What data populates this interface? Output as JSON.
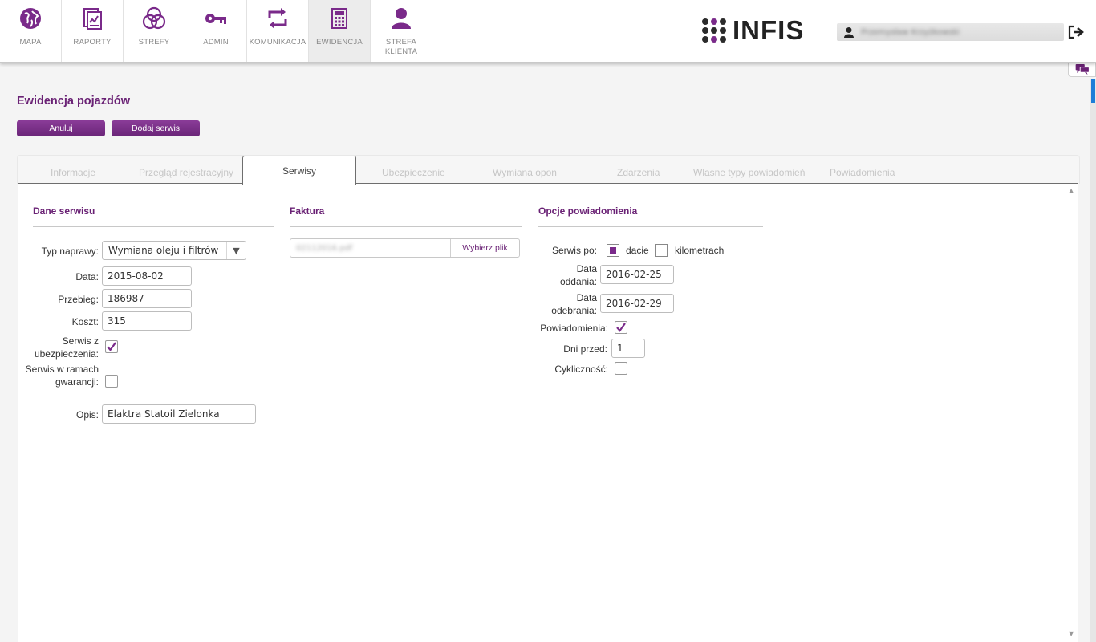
{
  "nav": {
    "items": [
      {
        "label": "MAPA",
        "icon": "globe-icon"
      },
      {
        "label": "RAPORTY",
        "icon": "report-icon"
      },
      {
        "label": "STREFY",
        "icon": "zones-icon"
      },
      {
        "label": "ADMIN",
        "icon": "key-icon"
      },
      {
        "label": "KOMUNIKACJA",
        "icon": "exchange-icon"
      },
      {
        "label": "EWIDENCJA",
        "icon": "calculator-icon"
      },
      {
        "label": "STREFA KLIENTA",
        "icon": "user-icon"
      }
    ],
    "active": "EWIDENCJA"
  },
  "brand": {
    "name": "INFIS"
  },
  "user": {
    "name": "Przemysław Krzyżkowski"
  },
  "page": {
    "title": "Ewidencja pojazdów"
  },
  "buttons": {
    "cancel": "Anuluj",
    "add_service": "Dodaj serwis"
  },
  "tabs": [
    "Informacje",
    "Przegląd rejestracyjny",
    "Serwisy",
    "Ubezpieczenie",
    "Wymiana opon",
    "Zdarzenia",
    "Własne typy powiadomień",
    "Powiadomienia"
  ],
  "active_tab": "Serwisy",
  "service": {
    "title": "Dane serwisu",
    "repair_type_label": "Typ naprawy:",
    "repair_type_value": "Wymiana oleju i filtrów",
    "date_label": "Data:",
    "date_value": "2015-08-02",
    "mileage_label": "Przebieg:",
    "mileage_value": "186987",
    "cost_label": "Koszt:",
    "cost_value": "315",
    "insurance_label": "Serwis z ubezpieczenia:",
    "insurance_checked": true,
    "warranty_label": "Serwis w ramach gwarancji:",
    "warranty_checked": false,
    "description_label": "Opis:",
    "description_value": "Elaktra Statoil Zielonka"
  },
  "invoice": {
    "title": "Faktura",
    "file_name": "02112016.pdf",
    "choose_file": "Wybierz plik"
  },
  "notify": {
    "title": "Opcje powiadomienia",
    "service_by_label": "Serwis po:",
    "by_date_label": "dacie",
    "by_km_label": "kilometrach",
    "by_date_selected": true,
    "by_km_selected": false,
    "handover_label": "Data oddania:",
    "handover_value": "2016-02-25",
    "pickup_label": "Data odebrania:",
    "pickup_value": "2016-02-29",
    "notifications_label": "Powiadomienia:",
    "notifications_checked": true,
    "days_before_label": "Dni przed:",
    "days_before_value": "1",
    "cyclic_label": "Cykliczność:",
    "cyclic_checked": false
  },
  "colors": {
    "accent": "#7a2a8a",
    "title": "#6a2275"
  }
}
